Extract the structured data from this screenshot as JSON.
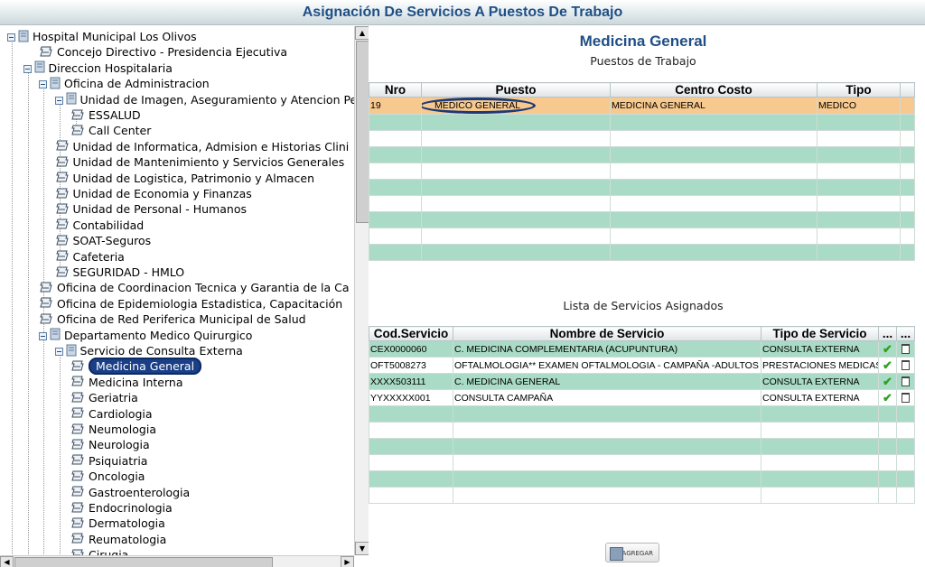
{
  "window": {
    "title": "Asignación De Servicios A Puestos De Trabajo"
  },
  "tree": {
    "nodes": [
      {
        "label": "Hospital Municipal Los Olivos",
        "type": "folder",
        "expanded": true
      },
      {
        "label": "Concejo Directivo - Presidencia Ejecutiva",
        "type": "leaf"
      },
      {
        "label": "Direccion Hospitalaria",
        "type": "folder",
        "expanded": true
      },
      {
        "label": "Oficina de Administracion",
        "type": "folder",
        "expanded": true
      },
      {
        "label": "Unidad de Imagen, Aseguramiento y Atencion Pe",
        "type": "folder",
        "expanded": true
      },
      {
        "label": "ESSALUD",
        "type": "leaf"
      },
      {
        "label": "Call Center",
        "type": "leaf"
      },
      {
        "label": "Unidad de Informatica, Admision e Historias Clini",
        "type": "leaf"
      },
      {
        "label": "Unidad de Mantenimiento y Servicios Generales",
        "type": "leaf"
      },
      {
        "label": "Unidad de Logistica, Patrimonio y Almacen",
        "type": "leaf"
      },
      {
        "label": "Unidad de Economia y Finanzas",
        "type": "leaf"
      },
      {
        "label": "Unidad de Personal - Humanos",
        "type": "leaf"
      },
      {
        "label": "Contabilidad",
        "type": "leaf"
      },
      {
        "label": "SOAT-Seguros",
        "type": "leaf"
      },
      {
        "label": "Cafeteria",
        "type": "leaf"
      },
      {
        "label": "SEGURIDAD - HMLO",
        "type": "leaf"
      },
      {
        "label": "Oficina de Coordinacion Tecnica y Garantia de la Ca",
        "type": "leaf"
      },
      {
        "label": "Oficina de Epidemiologia Estadistica, Capacitación",
        "type": "leaf"
      },
      {
        "label": "Oficina de Red Periferica Municipal de Salud",
        "type": "leaf"
      },
      {
        "label": "Departamento Medico Quirurgico",
        "type": "folder",
        "expanded": true
      },
      {
        "label": "Servicio de Consulta Externa",
        "type": "folder",
        "expanded": true
      },
      {
        "label": "Medicina General",
        "type": "leaf",
        "selected": true
      },
      {
        "label": "Medicina Interna",
        "type": "leaf"
      },
      {
        "label": "Geriatria",
        "type": "leaf"
      },
      {
        "label": "Cardiologia",
        "type": "leaf"
      },
      {
        "label": "Neumologia",
        "type": "leaf"
      },
      {
        "label": "Neurologia",
        "type": "leaf"
      },
      {
        "label": "Psiquiatria",
        "type": "leaf"
      },
      {
        "label": "Oncologia",
        "type": "leaf"
      },
      {
        "label": "Gastroenterologia",
        "type": "leaf"
      },
      {
        "label": "Endocrinologia",
        "type": "leaf"
      },
      {
        "label": "Dermatologia",
        "type": "leaf"
      },
      {
        "label": "Reumatologia",
        "type": "leaf"
      },
      {
        "label": "Cirugia",
        "type": "leaf"
      }
    ]
  },
  "puestos": {
    "title": "Medicina General",
    "subtitle": "Puestos de Trabajo",
    "columns": [
      "Nro",
      "Puesto",
      "Centro Costo",
      "Tipo"
    ],
    "rows": [
      {
        "nro": "19",
        "puesto": "MEDICO GENERAL",
        "centro_costo": "MEDICINA GENERAL",
        "tipo": "MEDICO"
      }
    ]
  },
  "servicios": {
    "title": "Lista de Servicios Asignados",
    "columns": [
      "Cod.Servicio",
      "Nombre de Servicio",
      "Tipo de Servicio",
      "...",
      "..."
    ],
    "rows": [
      {
        "cod": "CEX0000060",
        "nombre": "C. MEDICINA COMPLEMENTARIA (ACUPUNTURA)",
        "tipo": "CONSULTA EXTERNA"
      },
      {
        "cod": "OFT5008273",
        "nombre": "OFTALMOLOGIA** EXAMEN OFTALMOLOGIA - CAMPAÑA -ADULTOS",
        "tipo": "PRESTACIONES MEDICAS"
      },
      {
        "cod": "XXXX503111",
        "nombre": "C. MEDICINA GENERAL",
        "tipo": "CONSULTA EXTERNA"
      },
      {
        "cod": "YYXXXXX001",
        "nombre": "CONSULTA CAMPAÑA",
        "tipo": "CONSULTA EXTERNA"
      }
    ]
  },
  "actions": {
    "agregar_label": "AGREGAR"
  },
  "colors": {
    "title": "#1f4f86",
    "row_green": "#a9dbc6",
    "row_selected": "#f7c98f",
    "tree_selected": "#1a3f86"
  }
}
